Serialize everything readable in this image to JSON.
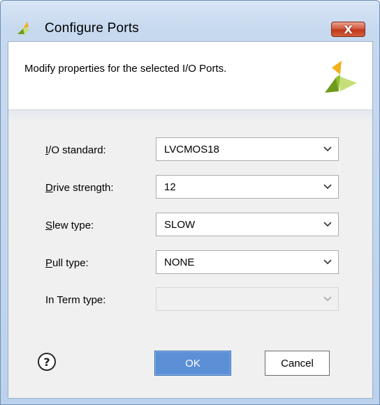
{
  "window": {
    "title": "Configure Ports",
    "close_glyph": "X"
  },
  "header": {
    "description": "Modify properties for the selected I/O Ports."
  },
  "form": {
    "rows": [
      {
        "label_mnemonic": "I",
        "label_rest": "/O standard:",
        "value": "LVCMOS18",
        "enabled": true
      },
      {
        "label_mnemonic": "D",
        "label_rest": "rive strength:",
        "value": "12",
        "enabled": true
      },
      {
        "label_mnemonic": "S",
        "label_rest": "lew type:",
        "value": "SLOW",
        "enabled": true
      },
      {
        "label_mnemonic": "P",
        "label_rest": "ull type:",
        "value": "NONE",
        "enabled": true
      },
      {
        "label_mnemonic": "",
        "label_rest": "In Term type:",
        "value": "",
        "enabled": false
      }
    ]
  },
  "footer": {
    "help_glyph": "?",
    "ok_label": "OK",
    "cancel_label": "Cancel"
  },
  "icons": {
    "app": "xilinx-logo-icon",
    "header": "xilinx-logo-icon",
    "help": "help-icon",
    "close": "close-icon",
    "dropdown": "chevron-down-icon"
  },
  "colors": {
    "ok_button": "#5b8fd6",
    "close_button": "#c7452a",
    "logo_green": "#8fbf2a",
    "logo_yellow": "#f2b11b"
  }
}
